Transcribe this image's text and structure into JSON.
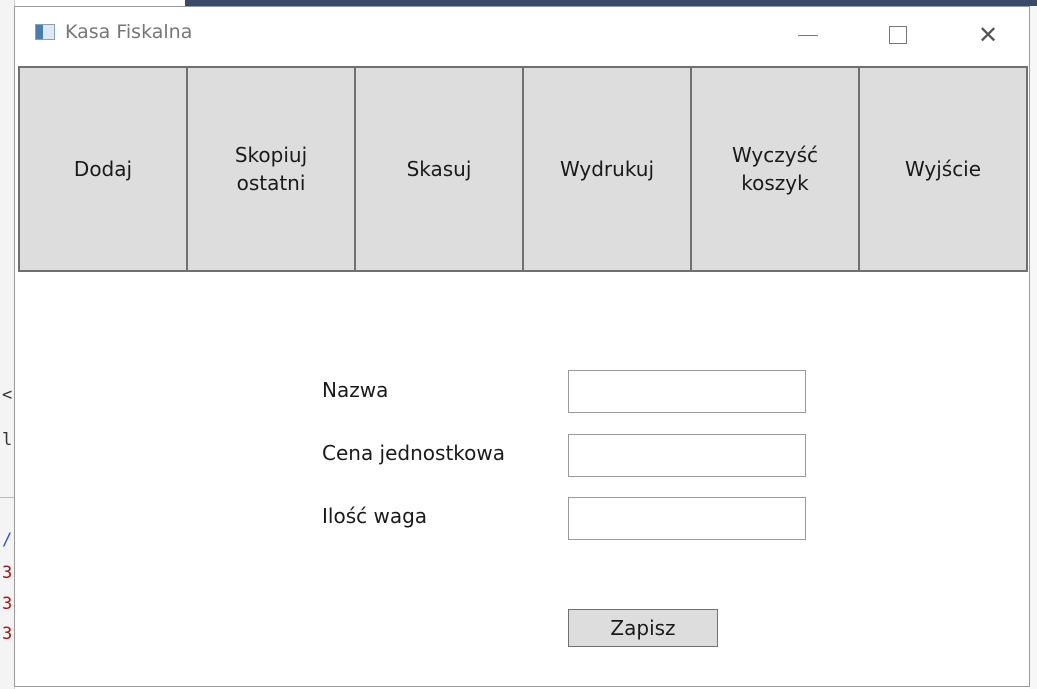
{
  "window": {
    "title": "Kasa Fiskalna",
    "controls": {
      "minimize": "—",
      "maximize": "□",
      "close": "✕"
    }
  },
  "toolbar": {
    "buttons": [
      {
        "label": "Dodaj"
      },
      {
        "label": "Skopiuj\nostatni"
      },
      {
        "label": "Skasuj"
      },
      {
        "label": "Wydrukuj"
      },
      {
        "label": "Wyczyść\nkoszyk"
      },
      {
        "label": "Wyjście"
      }
    ]
  },
  "form": {
    "fields": [
      {
        "label": "Nazwa",
        "value": ""
      },
      {
        "label": "Cena jednostkowa",
        "value": ""
      },
      {
        "label": "Ilość waga",
        "value": ""
      }
    ],
    "save_label": "Zapisz"
  },
  "background": {
    "glyphs": [
      "<",
      "l",
      "/",
      "3",
      "3",
      "3"
    ]
  }
}
